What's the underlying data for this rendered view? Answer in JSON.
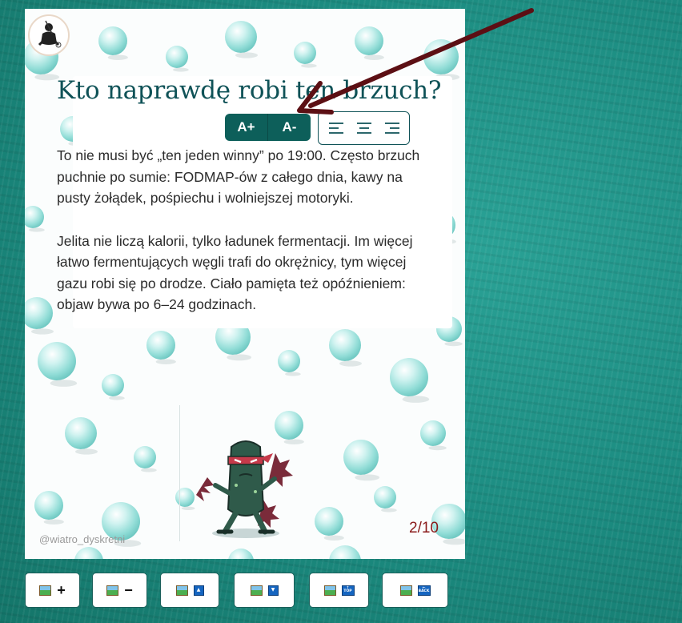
{
  "card": {
    "title": "Kto naprawdę robi ten brzuch?",
    "paragraphs": [
      "To nie musi być „ten jeden winny” po 19:00. Często brzuch puchnie po sumie: FODMAP-ów z całego dnia, kawy na pusty żołądek, pośpiechu i wolniejszej motoryki.",
      "Jelita nie liczą kalorii, tylko ładunek fermentacji. Im więcej łatwo fermentujących węgli trafi do okrężnicy, tym więcej gazu robi się po drodze. Ciało pamięta też opóźnieniem: objaw bywa po 6–24 godzinach."
    ],
    "handle": "@wiatro_dyskretni",
    "page": "2/10"
  },
  "font_controls": {
    "increase": "A+",
    "decrease": "A-"
  },
  "align_controls": [
    "align-left-icon",
    "align-center-icon",
    "align-right-icon"
  ],
  "toolbar": {
    "zoom_in_symbol": "+",
    "zoom_out_symbol": "−",
    "top_label": "TOP",
    "back_label": "BACK"
  },
  "colors": {
    "accent": "#0d5f5a",
    "title": "#0f5257",
    "page_number": "#8a1a1a",
    "arrow": "#5c0f14",
    "background": "#1f8f84"
  }
}
